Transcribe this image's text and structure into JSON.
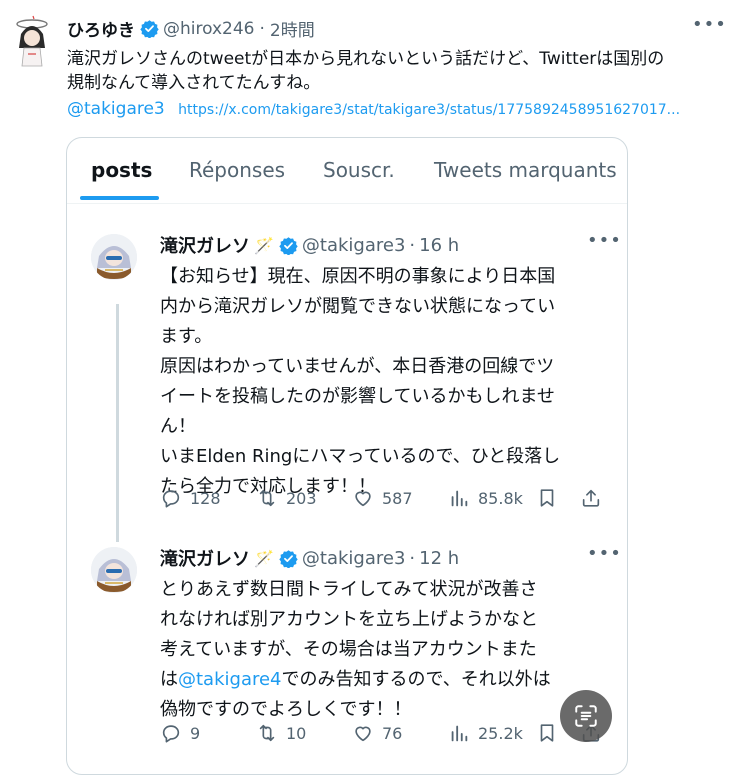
{
  "outer_tweet": {
    "author_name": "ひろゆき",
    "handle": "@hirox246",
    "separator": "·",
    "time": "2時間",
    "text_line1": "滝沢ガレソさんのtweetが日本から見れないという話だけど、Twitterは国別の",
    "text_line2": "規制なんて導入されてたんすね。",
    "mention": "@takigare3",
    "link_text": "https://x.com/takigare3/stat/takigare3/status/1775892458951627017..."
  },
  "embed": {
    "tabs": [
      {
        "label": "posts",
        "active": true
      },
      {
        "label": "Réponses",
        "active": false
      },
      {
        "label": "Souscr.",
        "active": false
      },
      {
        "label": "Tweets marquants",
        "active": false
      }
    ],
    "tweets": [
      {
        "author_name": "滝沢ガレソ",
        "emoji": "🪄",
        "handle": "@takigare3",
        "separator": "·",
        "time": "16 h",
        "lines": [
          "【お知らせ】現在、原因不明の事象により日本国",
          "内から滝沢ガレソが閲覧できない状態になってい",
          "ます。",
          "原因はわかっていませんが、本日香港の回線でツ",
          "イートを投稿したのが影響しているかもしれませ",
          "ん！",
          "いまElden Ringにハマっているので、ひと段落し",
          "たら全力で対応します！！"
        ],
        "replies": "128",
        "retweets": "203",
        "likes": "587",
        "views": "85.8k"
      },
      {
        "author_name": "滝沢ガレソ",
        "emoji": "🪄",
        "handle": "@takigare3",
        "separator": "·",
        "time": "12 h",
        "lines": [
          "とりあえず数日間トライしてみて状況が改善さ",
          "れなければ別アカウントを立ち上げようかなと",
          "考えていますが、その場合は当アカウントまた"
        ],
        "line4_prefix": "は",
        "line4_mention": "@takigare4",
        "line4_suffix": "でのみ告知するので、それ以外は",
        "line5": "偽物ですのでよろしくです！！",
        "replies": "9",
        "retweets": "10",
        "likes": "76",
        "views": "25.2k"
      }
    ]
  },
  "colors": {
    "accent": "#1d9bf0",
    "text": "#0f1419",
    "muted": "#536471",
    "border": "#cfd9de"
  },
  "icons": [
    "verified-badge-icon",
    "more-icon",
    "reply-icon",
    "retweet-icon",
    "like-icon",
    "views-icon",
    "bookmark-icon",
    "share-icon",
    "text-recognition-icon"
  ]
}
